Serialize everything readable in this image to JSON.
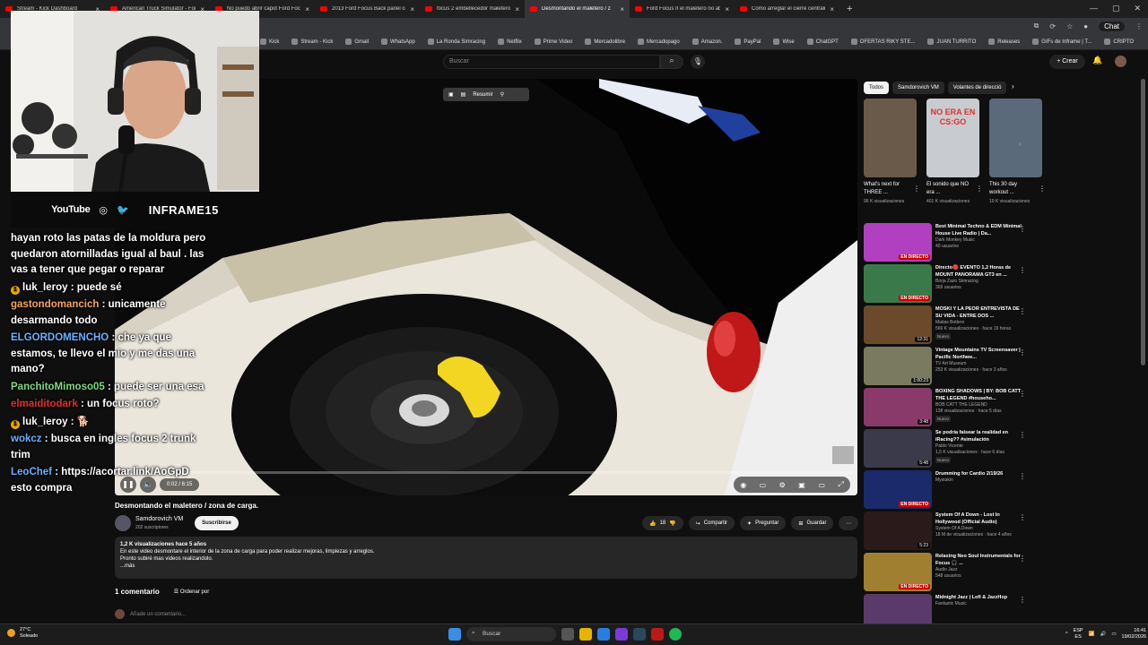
{
  "browser": {
    "tabs": [
      {
        "title": "Stream - Kick Dashboard",
        "active": false
      },
      {
        "title": "American Truck Simulator - Ford",
        "active": false
      },
      {
        "title": "No puedo abrir capot Ford Focus",
        "active": false
      },
      {
        "title": "2013 Ford Focus Back panel cover",
        "active": false
      },
      {
        "title": "focus 2 embellecedor maletero - B",
        "active": false
      },
      {
        "title": "Desmontando el maletero / z",
        "active": true
      },
      {
        "title": "Ford Focus II el maletero no abre",
        "active": false
      },
      {
        "title": "Cómo arreglar el cierre centralizado",
        "active": false
      }
    ],
    "new_tab": "+",
    "chat_label": "Chat",
    "bookmarks": [
      "Kick",
      "Stream - Kick",
      "Gmail",
      "WhatsApp",
      "La Ronda Simracing",
      "Netflix",
      "Prime Video",
      "Mercadolibre",
      "Mercadopago",
      "Amazon.",
      "PayPal",
      "Wise",
      "ChatGPT",
      "OFERTAS RIKY STE...",
      "JUAN TURRITO",
      "Releases",
      "GIFs de Inframe | T...",
      "CRIPTO"
    ]
  },
  "youtube": {
    "search_placeholder": "Buscar",
    "create_label": "+ Crear",
    "player": {
      "pill_label": "Resumir",
      "time": "0:02 / 6:15",
      "progress": 0.005
    },
    "video": {
      "title": "Desmontando el maletero / zona de carga.",
      "channel": "Samdorovich VM",
      "subscribers": "202 suscriptores",
      "subscribe_label": "Suscribirse",
      "likes": "18",
      "share_label": "Compartir",
      "ask_label": "Preguntar",
      "save_label": "Guardar",
      "desc_meta": "1,2 K visualizaciones  hace 5 años",
      "desc_line1": "En este video desmontare el interior de la zona de carga para poder realizar mejoras, limpiezas y arreglos.",
      "desc_line2": "Pronto subiré mas videos realizandolo.",
      "desc_more": "...más",
      "comments_count": "1 comentario",
      "sort_label": "Ordenar por",
      "add_comment": "Añade un comentario..."
    },
    "chips": [
      {
        "label": "Todos",
        "selected": true
      },
      {
        "label": "Samdorovich VM",
        "selected": false
      },
      {
        "label": "Volantes de direcció",
        "selected": false
      }
    ],
    "shorts": [
      {
        "title": "What's next for THREE ...",
        "views": "96 K visualizaciones",
        "color": "#6a5a4a",
        "overlay": ""
      },
      {
        "title": "El sonido que NO era ...",
        "views": "401 K visualizaciones",
        "color": "#c8ccd0",
        "overlay": "NO ERA EN CS:GO"
      },
      {
        "title": "This 30 day workout ...",
        "views": "19 K visualizaciones",
        "color": "#5a6a7a",
        "overlay": ""
      }
    ],
    "recommendations": [
      {
        "title": "Best Minimal Techno & EDM Minimal House Live Radio | Da...",
        "channel": "Dark Monkey Music",
        "meta": "40 usuarios",
        "badge": "EN DIRECTO",
        "live": true,
        "new": false,
        "color": "#b040c0"
      },
      {
        "title": "Directo🔴 EVENTO 1,2 Horas de MOUNT PANORAMA GT3 en ...",
        "channel": "Borja Zazo Simracing",
        "meta": "369 usuarios",
        "badge": "EN DIRECTO",
        "live": true,
        "new": false,
        "color": "#3a7a4a"
      },
      {
        "title": "MOSKI Y LA PEOR ENTREVISTA DE SU VIDA - ENTRE DOS ...",
        "channel": "Matias Bottero",
        "meta": "566 K visualizaciones · hace 19 horas",
        "badge": "12:31",
        "live": false,
        "new": true,
        "color": "#6a4a2a"
      },
      {
        "title": "Vintage Mountains TV Screensaver | Pacific Northwe...",
        "channel": "TV Art Museum",
        "meta": "253 K visualizaciones · hace 3 años",
        "badge": "1:00:23",
        "live": false,
        "new": false,
        "color": "#7a7a60"
      },
      {
        "title": "BOXING SHADOWS | BY: BOB CATT THE LEGEND #househo...",
        "channel": "BOB CATT THE LEGEND",
        "meta": "138 visualizaciones · hace 5 días",
        "badge": "3:48",
        "live": false,
        "new": true,
        "color": "#8a3a6a"
      },
      {
        "title": "Se podría falsear la realidad en iRacing?? #simulación",
        "channel": "Pablo Vicente",
        "meta": "1,5 K visualizaciones · hace 6 días",
        "badge": "5:48",
        "live": false,
        "new": true,
        "color": "#3a3a4a"
      },
      {
        "title": "Drumming for Cardio 2/19/26",
        "channel": "Mystakin",
        "meta": "",
        "badge": "EN DIRECTO",
        "live": true,
        "new": false,
        "color": "#1a2a6a"
      },
      {
        "title": "System Of A Down - Lost In Hollywood (Official Audio)",
        "channel": "System Of A Down",
        "meta": "18 M de visualizaciones · hace 4 años",
        "badge": "5:23",
        "live": false,
        "new": false,
        "color": "#2a1a1a"
      },
      {
        "title": "Relaxing Neo Soul Instrumentals for Focus 🎧 ...",
        "channel": "Audio Jazz",
        "meta": "548 usuarios",
        "badge": "EN DIRECTO",
        "live": true,
        "new": false,
        "color": "#a08030"
      },
      {
        "title": "Midnight Jazz | Lofi & JazzHop",
        "channel": "Fantastic Music",
        "meta": "",
        "badge": "",
        "live": false,
        "new": false,
        "color": "#5a3a6a"
      }
    ]
  },
  "overlay": {
    "social_youtube": "YouTube",
    "handle": "INFRAME15",
    "chat": [
      {
        "user": "",
        "user_color": "#ffffff",
        "badge": "",
        "text": "hayan roto las patas de la moldura pero quedaron atornilladas igual al baul . las vas a tener que pegar o reparar"
      },
      {
        "user": "luk_leroy",
        "user_color": "#ffffff",
        "badge": "1",
        "text": "puede sé"
      },
      {
        "user": "gastondomancich",
        "user_color": "#f4a460",
        "badge": "",
        "text": "unicamente desarmando todo"
      },
      {
        "user": "ELGORDOMENCHO",
        "user_color": "#6ab0ff",
        "badge": "",
        "text": "che ya que estamos, te llevo el mio y me das una mano?"
      },
      {
        "user": "PanchitoMimoso05",
        "user_color": "#7fd97f",
        "badge": "",
        "text": "puede ser una esa"
      },
      {
        "user": "elmaiditodark",
        "user_color": "#e03030",
        "badge": "",
        "text": "un focus roto?"
      },
      {
        "user": "luk_leroy",
        "user_color": "#ffffff",
        "badge": "1",
        "text": "🐕"
      },
      {
        "user": "wokcz",
        "user_color": "#6ab0ff",
        "badge": "",
        "text": "busca en ingles focus 2 trunk trim"
      },
      {
        "user": "LeoChef",
        "user_color": "#6ab0ff",
        "badge": "",
        "text": "https://acortar.link/AoGpD esto compra"
      }
    ]
  },
  "taskbar": {
    "temperature": "27°C",
    "weather": "Soleado",
    "search_label": "Buscar",
    "lang": "ESP",
    "region": "ES",
    "time": "16:41",
    "date": "19/02/2026"
  }
}
